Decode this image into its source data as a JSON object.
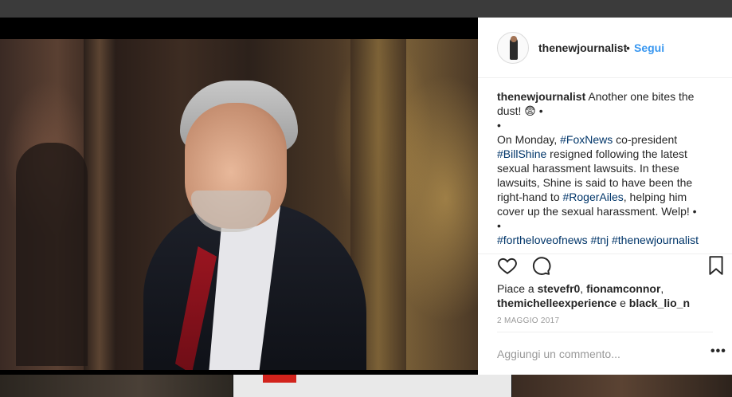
{
  "post": {
    "username": "thenewjournalist",
    "separator": "•",
    "follow_label": "Segui",
    "caption": {
      "author": "thenewjournalist",
      "line1": "Another one bites the dust! 😨 •",
      "line2": "•",
      "line3_prefix": "On Monday, ",
      "tag_foxnews": "#FoxNews",
      "line3_suffix": " co-president",
      "tag_billshine": "#BillShine",
      "line4_suffix": " resigned following the latest sexual harassment lawsuits. In these lawsuits, Shine is said to have been the right-hand to ",
      "tag_rogerailes": "#RogerAiles",
      "line5_suffix": ", helping him cover up the sexual harassment. Welp! •",
      "line6": "•",
      "tags": [
        "#fortheloveofnews",
        "#tnj",
        "#thenewjournalist"
      ]
    },
    "likes": {
      "prefix": "Piace a ",
      "user1": "stevefr0",
      "comma": ", ",
      "user2": "fionamconnor",
      "comma2": ",",
      "user3": "themichelleexperience",
      "and": " e ",
      "user4": "black_lio_n"
    },
    "date": "2 MAGGIO 2017",
    "comment_placeholder": "Aggiungi un commento...",
    "more_options": "•••"
  },
  "icons": {
    "like": "heart-icon",
    "comment": "comment-icon",
    "save": "bookmark-icon",
    "options": "more-options-icon"
  },
  "colors": {
    "link": "#3897f0",
    "hashtag": "#003569",
    "text": "#262626",
    "muted": "#999999"
  }
}
